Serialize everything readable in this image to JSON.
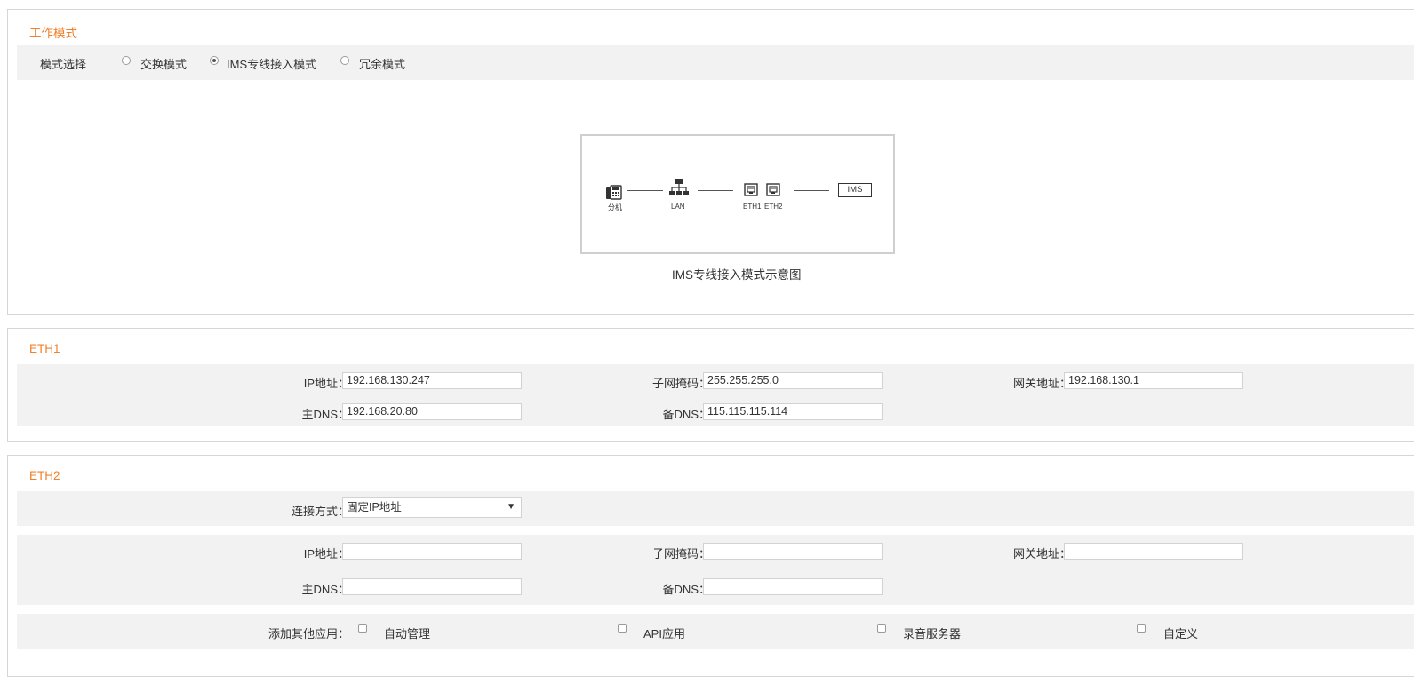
{
  "work_mode": {
    "title": "工作模式",
    "mode_label": "模式选择",
    "options": [
      {
        "label": "交换模式",
        "checked": false
      },
      {
        "label": "IMS专线接入模式",
        "checked": true
      },
      {
        "label": "冗余模式",
        "checked": false
      }
    ],
    "diagram": {
      "caption": "IMS专线接入模式示意图",
      "nodes": {
        "extension": "分机",
        "lan": "LAN",
        "eth1": "ETH1",
        "eth2": "ETH2",
        "ims": "IMS"
      },
      "icons": [
        "phone-icon",
        "network-switch-icon",
        "ethernet-port-icon",
        "ethernet-port-icon"
      ]
    }
  },
  "eth1": {
    "title": "ETH1",
    "ip_label": "IP地址：",
    "ip_value": "192.168.130.247",
    "mask_label": "子网掩码：",
    "mask_value": "255.255.255.0",
    "gateway_label": "网关地址：",
    "gateway_value": "192.168.130.1",
    "dns1_label": "主DNS：",
    "dns1_value": "192.168.20.80",
    "dns2_label": "备DNS：",
    "dns2_value": "115.115.115.114"
  },
  "eth2": {
    "title": "ETH2",
    "conn_label": "连接方式：",
    "conn_value": "固定IP地址",
    "ip_label": "IP地址：",
    "ip_value": "",
    "mask_label": "子网掩码：",
    "mask_value": "",
    "gateway_label": "网关地址：",
    "gateway_value": "",
    "dns1_label": "主DNS：",
    "dns1_value": "",
    "dns2_label": "备DNS：",
    "dns2_value": "",
    "apps_label": "添加其他应用：",
    "apps": [
      {
        "label": "自动管理",
        "checked": false
      },
      {
        "label": "API应用",
        "checked": false
      },
      {
        "label": "录音服务器",
        "checked": false
      },
      {
        "label": "自定义",
        "checked": false
      }
    ]
  }
}
